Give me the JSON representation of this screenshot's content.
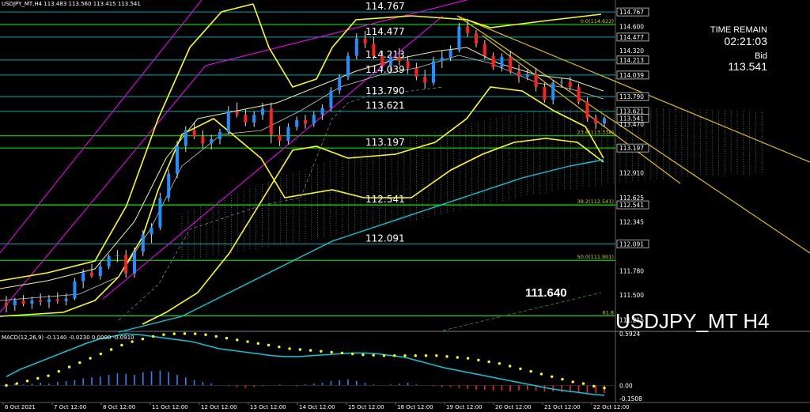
{
  "header": {
    "symbol_info": "USDJPY_MT,H4  113.483 113.560 113.415 113.541",
    "macd_info": "MACD(12,26,9) -0.1140 -0.0230 0.0000 -0.0910"
  },
  "overlay": {
    "symbol_label": "USDJPY_MT H4",
    "highlight_price": "111.640",
    "time_remain_label": "TIME REMAIN",
    "time_remain_value": "02:21:03",
    "bid_label": "Bid",
    "bid_value": "113.541"
  },
  "colors": {
    "background": "#000000",
    "bull_candle": "#1e90ff",
    "bear_candle": "#ff2020",
    "level_line": "#00ff00",
    "band_line": "#ffff00",
    "channel_line": "#ff00ff",
    "ma_line": "#00ccdd",
    "macd_line": "#00ccdd",
    "signal_dots": "#ffff00"
  },
  "chart_data": {
    "type": "candlestick",
    "title": "USDJPY_MT H4",
    "x_tick_labels": [
      "6 Oct 2021",
      "7 Oct 12:00",
      "8 Oct 12:00",
      "11 Oct 12:00",
      "12 Oct 12:00",
      "13 Oct 12:00",
      "14 Oct 12:00",
      "15 Oct 12:00",
      "18 Oct 12:00",
      "19 Oct 12:00",
      "20 Oct 12:00",
      "21 Oct 12:00",
      "22 Oct 12:00"
    ],
    "y_ticks": [
      "114.767",
      "114.600",
      "114.477",
      "114.320",
      "114.213",
      "114.039",
      "113.790",
      "113.621",
      "113.541",
      "113.470",
      "113.197",
      "112.910",
      "112.625",
      "112.541",
      "112.345",
      "112.091",
      "111.780",
      "111.500",
      "111.215"
    ],
    "y_tick_styles": [
      "box",
      "plain",
      "box",
      "plain",
      "box",
      "box",
      "box",
      "box",
      "box",
      "plain",
      "box",
      "plain",
      "plain",
      "box",
      "plain",
      "box",
      "plain",
      "plain",
      "plain"
    ],
    "ylim": [
      111.1,
      114.85
    ],
    "levels": [
      {
        "price": 114.767,
        "label": "114.767"
      },
      {
        "price": 114.477,
        "label": "114.477"
      },
      {
        "price": 114.213,
        "label": "114.213"
      },
      {
        "price": 114.039,
        "label": "114.039"
      },
      {
        "price": 113.79,
        "label": "113.790"
      },
      {
        "price": 113.621,
        "label": "113.621"
      },
      {
        "price": 113.197,
        "label": "113.197"
      },
      {
        "price": 112.541,
        "label": "112.541"
      },
      {
        "price": 112.091,
        "label": "112.091"
      }
    ],
    "fib_levels": [
      {
        "price": 114.622,
        "label": "0.0(114.622)"
      },
      {
        "price": 113.338,
        "label": "23.6(113.338)"
      },
      {
        "price": 112.541,
        "label": "38.2(112.541)"
      },
      {
        "price": 111.901,
        "label": "50.0(111.901)"
      },
      {
        "price": 111.26,
        "label": "61.8"
      }
    ],
    "candles": [
      [
        111.41,
        111.49,
        111.3,
        111.38
      ],
      [
        111.38,
        111.47,
        111.32,
        111.44
      ],
      [
        111.44,
        111.5,
        111.37,
        111.4
      ],
      [
        111.4,
        111.48,
        111.34,
        111.44
      ],
      [
        111.44,
        111.52,
        111.38,
        111.42
      ],
      [
        111.42,
        111.5,
        111.35,
        111.45
      ],
      [
        111.45,
        111.53,
        111.4,
        111.43
      ],
      [
        111.43,
        111.52,
        111.38,
        111.46
      ],
      [
        111.46,
        111.7,
        111.44,
        111.66
      ],
      [
        111.66,
        111.8,
        111.58,
        111.76
      ],
      [
        111.76,
        111.86,
        111.7,
        111.72
      ],
      [
        111.72,
        111.88,
        111.68,
        111.83
      ],
      [
        111.83,
        111.97,
        111.8,
        111.95
      ],
      [
        111.95,
        112.02,
        111.88,
        111.96
      ],
      [
        111.96,
        112.02,
        111.7,
        111.75
      ],
      [
        111.75,
        112.05,
        111.7,
        112.0
      ],
      [
        112.0,
        112.25,
        111.95,
        112.2
      ],
      [
        112.2,
        112.33,
        112.1,
        112.28
      ],
      [
        112.28,
        112.68,
        112.25,
        112.62
      ],
      [
        112.62,
        112.95,
        112.58,
        112.9
      ],
      [
        112.9,
        113.28,
        112.85,
        113.22
      ],
      [
        113.22,
        113.45,
        113.15,
        113.4
      ],
      [
        113.4,
        113.5,
        113.3,
        113.33
      ],
      [
        113.33,
        113.4,
        113.2,
        113.25
      ],
      [
        113.25,
        113.35,
        113.18,
        113.3
      ],
      [
        113.3,
        113.42,
        113.24,
        113.38
      ],
      [
        113.38,
        113.68,
        113.35,
        113.62
      ],
      [
        113.62,
        113.72,
        113.55,
        113.58
      ],
      [
        113.58,
        113.64,
        113.45,
        113.49
      ],
      [
        113.49,
        113.62,
        113.44,
        113.58
      ],
      [
        113.58,
        113.72,
        113.52,
        113.65
      ],
      [
        113.65,
        113.72,
        113.25,
        113.35
      ],
      [
        113.35,
        113.45,
        113.22,
        113.28
      ],
      [
        113.28,
        113.48,
        113.24,
        113.44
      ],
      [
        113.44,
        113.56,
        113.4,
        113.52
      ],
      [
        113.52,
        113.58,
        113.42,
        113.48
      ],
      [
        113.48,
        113.62,
        113.44,
        113.58
      ],
      [
        113.58,
        113.7,
        113.52,
        113.66
      ],
      [
        113.66,
        113.9,
        113.62,
        113.86
      ],
      [
        113.86,
        114.05,
        113.82,
        114.02
      ],
      [
        114.02,
        114.3,
        113.98,
        114.26
      ],
      [
        114.26,
        114.52,
        114.22,
        114.46
      ],
      [
        114.46,
        114.55,
        114.35,
        114.4
      ],
      [
        114.4,
        114.48,
        114.22,
        114.26
      ],
      [
        114.26,
        114.32,
        114.1,
        114.15
      ],
      [
        114.15,
        114.3,
        114.08,
        114.25
      ],
      [
        114.25,
        114.35,
        114.15,
        114.2
      ],
      [
        114.2,
        114.26,
        114.05,
        114.12
      ],
      [
        114.12,
        114.18,
        113.98,
        114.02
      ],
      [
        114.02,
        114.1,
        113.88,
        113.95
      ],
      [
        113.95,
        114.25,
        113.92,
        114.2
      ],
      [
        114.2,
        114.32,
        114.12,
        114.24
      ],
      [
        114.24,
        114.38,
        114.2,
        114.33
      ],
      [
        114.33,
        114.64,
        114.3,
        114.6
      ],
      [
        114.6,
        114.69,
        114.48,
        114.52
      ],
      [
        114.52,
        114.56,
        114.36,
        114.4
      ],
      [
        114.4,
        114.44,
        114.22,
        114.26
      ],
      [
        114.26,
        114.3,
        114.1,
        114.13
      ],
      [
        114.13,
        114.29,
        114.08,
        114.25
      ],
      [
        114.25,
        114.32,
        114.05,
        114.08
      ],
      [
        114.08,
        114.16,
        113.95,
        114.02
      ],
      [
        114.02,
        114.1,
        113.98,
        114.05
      ],
      [
        114.05,
        114.12,
        113.85,
        113.9
      ],
      [
        113.9,
        113.95,
        113.72,
        113.75
      ],
      [
        113.75,
        113.98,
        113.7,
        113.95
      ],
      [
        113.95,
        114.0,
        113.9,
        113.96
      ],
      [
        113.96,
        114.02,
        113.86,
        113.9
      ],
      [
        113.9,
        113.94,
        113.7,
        113.73
      ],
      [
        113.73,
        113.78,
        113.5,
        113.54
      ],
      [
        113.54,
        113.58,
        113.42,
        113.48
      ],
      [
        113.48,
        113.56,
        113.44,
        113.54
      ]
    ],
    "macd": {
      "ylim": [
        -0.16,
        0.6
      ],
      "y_ticks": [
        "0.5924",
        "0.00",
        "-0.1508"
      ],
      "signal_shape": [
        0.0,
        0.02,
        0.05,
        0.08,
        0.11,
        0.16,
        0.21,
        0.26,
        0.31,
        0.36,
        0.41,
        0.46,
        0.5,
        0.53,
        0.56,
        0.58,
        0.59,
        0.592,
        0.59,
        0.58,
        0.56,
        0.54,
        0.52,
        0.5,
        0.48,
        0.46,
        0.44,
        0.42,
        0.41,
        0.4,
        0.39,
        0.38,
        0.37,
        0.36,
        0.35,
        0.345,
        0.34,
        0.34,
        0.34,
        0.34,
        0.34,
        0.34,
        0.33,
        0.32,
        0.31,
        0.29,
        0.27,
        0.25,
        0.22,
        0.19,
        0.16,
        0.13,
        0.1,
        0.07,
        0.04,
        0.02,
        -0.01,
        -0.03
      ],
      "macd_shape": [
        0.1,
        0.18,
        0.24,
        0.3,
        0.36,
        0.42,
        0.48,
        0.53,
        0.56,
        0.59,
        0.58,
        0.56,
        0.54,
        0.52,
        0.5,
        0.46,
        0.42,
        0.4,
        0.38,
        0.36,
        0.34,
        0.33,
        0.33,
        0.34,
        0.35,
        0.36,
        0.37,
        0.37,
        0.36,
        0.34,
        0.32,
        0.28,
        0.24,
        0.2,
        0.17,
        0.14,
        0.11,
        0.08,
        0.05,
        0.02,
        -0.01,
        -0.04,
        -0.06,
        -0.08,
        -0.1,
        -0.114
      ],
      "histogram": [
        0.01,
        0.02,
        0.01,
        0.02,
        0.03,
        0.02,
        0.04,
        0.05,
        0.06,
        0.08,
        0.09,
        0.1,
        0.12,
        0.14,
        0.13,
        0.12,
        0.15,
        0.16,
        0.17,
        0.15,
        0.12,
        0.09,
        0.06,
        0.04,
        0.02,
        0.0,
        -0.01,
        -0.02,
        -0.03,
        -0.02,
        -0.01,
        0.0,
        0.01,
        0.0,
        -0.01,
        0.01,
        0.02,
        0.03,
        0.05,
        0.06,
        0.07,
        0.05,
        0.03,
        0.01,
        0.0,
        0.01,
        0.02,
        0.03,
        0.01,
        0.0,
        -0.01,
        -0.02,
        -0.02,
        -0.03,
        -0.04,
        -0.05,
        -0.05,
        -0.06,
        -0.06,
        -0.07,
        -0.06,
        -0.05,
        -0.06,
        -0.07,
        -0.07,
        -0.08,
        -0.08,
        -0.09,
        -0.09,
        -0.09,
        -0.09
      ]
    }
  }
}
